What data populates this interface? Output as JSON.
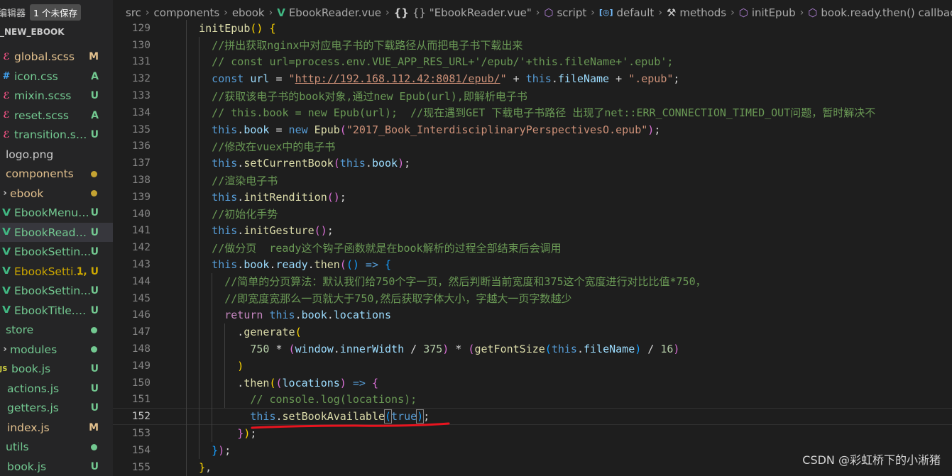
{
  "sidebar": {
    "header_title": "的编辑器",
    "unsaved_badge": "1 个未保存",
    "project": "_NEW_EBOOK",
    "items": [
      {
        "name": "global.scss",
        "icon": "sass",
        "status": "M",
        "status_color": "#e2c08d",
        "color": "#e2c08d",
        "indent": 3
      },
      {
        "name": "icon.css",
        "icon": "css",
        "status": "A",
        "status_color": "#73c991",
        "color": "#73c991",
        "indent": 3
      },
      {
        "name": "mixin.scss",
        "icon": "sass",
        "status": "U",
        "status_color": "#73c991",
        "color": "#73c991",
        "indent": 3
      },
      {
        "name": "reset.scss",
        "icon": "sass",
        "status": "A",
        "status_color": "#73c991",
        "color": "#73c991",
        "indent": 3
      },
      {
        "name": "transition.scss",
        "icon": "sass",
        "status": "U",
        "status_color": "#73c991",
        "color": "#73c991",
        "indent": 3
      },
      {
        "name": "logo.png",
        "icon": "image",
        "status": "",
        "status_color": "",
        "color": "#cccccc",
        "indent": 0
      },
      {
        "name": "components",
        "icon": "",
        "status": "dot",
        "status_color": "#c5a332",
        "color": "#e2c08d",
        "indent": 0
      },
      {
        "name": "ebook",
        "icon": "chev",
        "status": "dot",
        "status_color": "#c5a332",
        "color": "#e2c08d",
        "indent": 0
      },
      {
        "name": "EbookMenu....",
        "icon": "vue",
        "status": "U",
        "status_color": "#73c991",
        "color": "#73c991",
        "indent": 3
      },
      {
        "name": "EbookReade...",
        "icon": "vue",
        "status": "U",
        "status_color": "#73c991",
        "color": "#73c991",
        "indent": 3,
        "selected": true
      },
      {
        "name": "EbookSettin...",
        "icon": "vue",
        "status": "U",
        "status_color": "#73c991",
        "color": "#73c991",
        "indent": 3
      },
      {
        "name": "EbookSetti...",
        "icon": "vue",
        "status": "1, U",
        "status_color": "#cca700",
        "color": "#cca700",
        "indent": 3
      },
      {
        "name": "EbookSettin...",
        "icon": "vue",
        "status": "U",
        "status_color": "#73c991",
        "color": "#73c991",
        "indent": 3
      },
      {
        "name": "EbookTitle.v...",
        "icon": "vue",
        "status": "U",
        "status_color": "#73c991",
        "color": "#73c991",
        "indent": 3
      },
      {
        "name": "store",
        "icon": "",
        "status": "dot",
        "status_color": "#73c991",
        "color": "#73c991",
        "indent": 0
      },
      {
        "name": "modules",
        "icon": "chev",
        "status": "dot",
        "status_color": "#73c991",
        "color": "#73c991",
        "indent": 0
      },
      {
        "name": "book.js",
        "icon": "js",
        "status": "U",
        "status_color": "#73c991",
        "color": "#73c991",
        "indent": 3
      },
      {
        "name": "actions.js",
        "icon": "",
        "status": "U",
        "status_color": "#73c991",
        "color": "#73c991",
        "indent": 3
      },
      {
        "name": "getters.js",
        "icon": "",
        "status": "U",
        "status_color": "#73c991",
        "color": "#73c991",
        "indent": 3
      },
      {
        "name": "index.js",
        "icon": "",
        "status": "M",
        "status_color": "#e2c08d",
        "color": "#e2c08d",
        "indent": 3
      },
      {
        "name": "utils",
        "icon": "",
        "status": "dot",
        "status_color": "#73c991",
        "color": "#73c991",
        "indent": 0
      },
      {
        "name": "book.js",
        "icon": "",
        "status": "U",
        "status_color": "#73c991",
        "color": "#73c991",
        "indent": 3
      }
    ]
  },
  "breadcrumb": [
    "src",
    "components",
    "ebook",
    "EbookReader.vue",
    "{} \"EbookReader.vue\"",
    "script",
    "default",
    "methods",
    "initEpub",
    "book.ready.then() callback"
  ],
  "breadcrumb_icons": [
    "",
    "",
    "",
    "vue-icon",
    "braces-icon",
    "cube-icon",
    "object-icon",
    "wrench-icon",
    "cube-icon",
    "cube-icon"
  ],
  "editor": {
    "current_line": 152,
    "lines": [
      {
        "n": 129,
        "i": 4,
        "t": [
          [
            "f",
            "initEpub"
          ],
          [
            "b1",
            "()"
          ],
          [
            "o",
            " "
          ],
          [
            "b1",
            "{"
          ]
        ]
      },
      {
        "n": 130,
        "i": 6,
        "t": [
          [
            "c",
            "//拼出获取nginx中对应电子书的下载路径从而把电子书下载出来"
          ]
        ]
      },
      {
        "n": 131,
        "i": 6,
        "t": [
          [
            "c",
            "// const url=process.env.VUE_APP_RES_URL+'/epub/'+this.fileName+'.epub';"
          ]
        ]
      },
      {
        "n": 132,
        "i": 6,
        "t": [
          [
            "k",
            "const"
          ],
          [
            "o",
            " "
          ],
          [
            "p",
            "url"
          ],
          [
            "o",
            " = "
          ],
          [
            "s",
            "\""
          ],
          [
            "su",
            "http://192.168.112.42:8081/epub/"
          ],
          [
            "s",
            "\""
          ],
          [
            "o",
            " + "
          ],
          [
            "k",
            "this"
          ],
          [
            "o",
            "."
          ],
          [
            "p",
            "fileName"
          ],
          [
            "o",
            " + "
          ],
          [
            "s",
            "\".epub\""
          ],
          [
            "o",
            ";"
          ]
        ]
      },
      {
        "n": 133,
        "i": 6,
        "t": [
          [
            "c",
            "//获取该电子书的book对象,通过new Epub(url),即解析电子书"
          ]
        ]
      },
      {
        "n": 134,
        "i": 6,
        "t": [
          [
            "c",
            "// this.book = new Epub(url);  //现在遇到GET 下载电子书路径 出现了net::ERR_CONNECTION_TIMED_OUT问题，暂时解决不"
          ]
        ]
      },
      {
        "n": 135,
        "i": 6,
        "t": [
          [
            "k",
            "this"
          ],
          [
            "o",
            "."
          ],
          [
            "p",
            "book"
          ],
          [
            "o",
            " = "
          ],
          [
            "k",
            "new"
          ],
          [
            "o",
            " "
          ],
          [
            "f",
            "Epub"
          ],
          [
            "b2",
            "("
          ],
          [
            "s",
            "\"2017_Book_InterdisciplinaryPerspectivesO.epub\""
          ],
          [
            "b2",
            ")"
          ],
          [
            "o",
            ";"
          ]
        ]
      },
      {
        "n": 136,
        "i": 6,
        "t": [
          [
            "c",
            "//修改在vuex中的电子书"
          ]
        ]
      },
      {
        "n": 137,
        "i": 6,
        "t": [
          [
            "k",
            "this"
          ],
          [
            "o",
            "."
          ],
          [
            "f",
            "setCurrentBook"
          ],
          [
            "b2",
            "("
          ],
          [
            "k",
            "this"
          ],
          [
            "o",
            "."
          ],
          [
            "p",
            "book"
          ],
          [
            "b2",
            ")"
          ],
          [
            "o",
            ";"
          ]
        ]
      },
      {
        "n": 138,
        "i": 6,
        "t": [
          [
            "c",
            "//渲染电子书"
          ]
        ]
      },
      {
        "n": 139,
        "i": 6,
        "t": [
          [
            "k",
            "this"
          ],
          [
            "o",
            "."
          ],
          [
            "f",
            "initRendition"
          ],
          [
            "b2",
            "()"
          ],
          [
            "o",
            ";"
          ]
        ]
      },
      {
        "n": 140,
        "i": 6,
        "t": [
          [
            "c",
            "//初始化手势"
          ]
        ]
      },
      {
        "n": 141,
        "i": 6,
        "t": [
          [
            "k",
            "this"
          ],
          [
            "o",
            "."
          ],
          [
            "f",
            "initGesture"
          ],
          [
            "b2",
            "()"
          ],
          [
            "o",
            ";"
          ]
        ]
      },
      {
        "n": 142,
        "i": 6,
        "t": [
          [
            "c",
            "//做分页  ready这个钩子函数就是在book解析的过程全部结束后会调用"
          ]
        ]
      },
      {
        "n": 143,
        "i": 6,
        "t": [
          [
            "k",
            "this"
          ],
          [
            "o",
            "."
          ],
          [
            "p",
            "book"
          ],
          [
            "o",
            "."
          ],
          [
            "p",
            "ready"
          ],
          [
            "o",
            "."
          ],
          [
            "f",
            "then"
          ],
          [
            "b2",
            "("
          ],
          [
            "b3",
            "()"
          ],
          [
            "o",
            " "
          ],
          [
            "k",
            "=>"
          ],
          [
            "o",
            " "
          ],
          [
            "b3",
            "{"
          ]
        ]
      },
      {
        "n": 144,
        "i": 8,
        "t": [
          [
            "c",
            "//简单的分页算法：默认我们给750个字一页，然后判断当前宽度和375这个宽度进行对比比值*750，"
          ]
        ]
      },
      {
        "n": 145,
        "i": 8,
        "t": [
          [
            "c",
            "//即宽度宽那么一页就大于750,然后获取字体大小，字越大一页字数越少"
          ]
        ]
      },
      {
        "n": 146,
        "i": 8,
        "t": [
          [
            "kc",
            "return"
          ],
          [
            "o",
            " "
          ],
          [
            "k",
            "this"
          ],
          [
            "o",
            "."
          ],
          [
            "p",
            "book"
          ],
          [
            "o",
            "."
          ],
          [
            "p",
            "locations"
          ]
        ]
      },
      {
        "n": 147,
        "i": 10,
        "t": [
          [
            "o",
            "."
          ],
          [
            "f",
            "generate"
          ],
          [
            "b1",
            "("
          ]
        ]
      },
      {
        "n": 148,
        "i": 12,
        "t": [
          [
            "n",
            "750"
          ],
          [
            "o",
            " * "
          ],
          [
            "b2",
            "("
          ],
          [
            "p",
            "window"
          ],
          [
            "o",
            "."
          ],
          [
            "p",
            "innerWidth"
          ],
          [
            "o",
            " / "
          ],
          [
            "n",
            "375"
          ],
          [
            "b2",
            ")"
          ],
          [
            "o",
            " * "
          ],
          [
            "b2",
            "("
          ],
          [
            "f",
            "getFontSize"
          ],
          [
            "b3",
            "("
          ],
          [
            "k",
            "this"
          ],
          [
            "o",
            "."
          ],
          [
            "p",
            "fileName"
          ],
          [
            "b3",
            ")"
          ],
          [
            "o",
            " / "
          ],
          [
            "n",
            "16"
          ],
          [
            "b2",
            ")"
          ]
        ]
      },
      {
        "n": 149,
        "i": 10,
        "t": [
          [
            "b1",
            ")"
          ]
        ]
      },
      {
        "n": 150,
        "i": 10,
        "t": [
          [
            "o",
            "."
          ],
          [
            "f",
            "then"
          ],
          [
            "b1",
            "("
          ],
          [
            "b2",
            "("
          ],
          [
            "p",
            "locations"
          ],
          [
            "b2",
            ")"
          ],
          [
            "o",
            " "
          ],
          [
            "k",
            "=>"
          ],
          [
            "o",
            " "
          ],
          [
            "b2",
            "{"
          ]
        ]
      },
      {
        "n": 151,
        "i": 12,
        "t": [
          [
            "c",
            "// console.log(locations);"
          ]
        ]
      },
      {
        "n": 152,
        "i": 12,
        "t": [
          [
            "k",
            "this"
          ],
          [
            "o",
            "."
          ],
          [
            "f",
            "setBookAvailable"
          ],
          [
            "b3h",
            "("
          ],
          [
            "k",
            "true"
          ],
          [
            "b3h",
            ")"
          ],
          [
            "o",
            ";"
          ]
        ]
      },
      {
        "n": 153,
        "i": 10,
        "t": [
          [
            "b2",
            "}"
          ],
          [
            "b1",
            ")"
          ],
          [
            "o",
            ";"
          ]
        ]
      },
      {
        "n": 154,
        "i": 6,
        "t": [
          [
            "b3",
            "}"
          ],
          [
            "b2",
            ")"
          ],
          [
            "o",
            ";"
          ]
        ]
      },
      {
        "n": 155,
        "i": 4,
        "t": [
          [
            "b1",
            "}"
          ],
          [
            "o",
            ","
          ]
        ]
      }
    ]
  },
  "watermark": "CSDN @彩虹桥下的小淅猪"
}
